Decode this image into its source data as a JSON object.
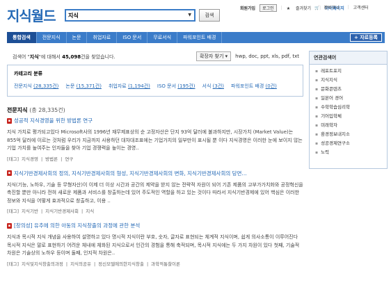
{
  "header": {
    "logo": "지식월드",
    "search_value": "지식",
    "search_button": "검색",
    "links_left": [
      "회원가입",
      "로그인",
      "즐겨찾기",
      "마이페이지"
    ],
    "links_right": [
      "장바구니",
      "고객센터"
    ]
  },
  "nav": {
    "tabs": [
      "통합검색",
      "전문지식",
      "논문",
      "취업자료",
      "ISO 문서",
      "무료서식",
      "파워포인트 배경"
    ],
    "register_button": "+ 자료등록"
  },
  "summary": {
    "prefix": "검색어 \"",
    "query": "지식",
    "middle": "\"에 대해서 ",
    "count": "45,098",
    "suffix": "건을 찾았습니다."
  },
  "tools": {
    "extension_button": "확장자 찾기 ▾",
    "extensions": "hwp, doc, ppt, xls, pdf, txt"
  },
  "category": {
    "title": "카테고리 분류",
    "items": [
      {
        "label": "전문지식",
        "count": "(28,335건)"
      },
      {
        "label": "논문",
        "count": "(15,371건)"
      },
      {
        "label": "취업자료",
        "count": "(1,194건)"
      },
      {
        "label": "ISO 문서",
        "count": "(195건)"
      },
      {
        "label": "서식",
        "count": "(3건)"
      },
      {
        "label": "파워포인트 배경",
        "count": "(0건)"
      }
    ]
  },
  "related": {
    "title": "연관검색어",
    "items": [
      "레포트포지",
      "지식지식",
      "문화콘텐츠",
      "일본어 경어",
      "수학학습심리학",
      "기어입학체",
      "미래학자",
      "환경정보내지소",
      "성공경제연구소",
      "노력"
    ]
  },
  "section": {
    "title": "전문지식",
    "count": "(총 28,335건)"
  },
  "results": [
    {
      "title": "성공적 지식경영을 위한 방법론 연구",
      "desc": "지식 가치로 평가되고있다 Microsoft사의 1996년 재무제표상의 순 고정자산은 단지 93억 달러에 불과하지만, 시장가치 (Market Value)는 855억 달러에 이르는 것처럼 우리가 지금까지 사용하던 대차대조표에는 기업가치의 일부만이 표시될 뿐 이다 지식경영은 이러한 눈에 보이지 않는 기업 가치를 높여주는 인자들을 찾아 기업 경쟁력을 높이는 경영..",
      "tags": [
        "[태그]",
        "지식경영",
        "|",
        "방법론",
        "|",
        "연구"
      ]
    },
    {
      "title": "지식기반경제사회의 정의, 지식기반경제사회의 형성, 지식기반경제사회의 변화, 지식기반경제사회의 당면...",
      "desc": "지식(기능, 노하우, 기술 등 무형자산)이 이제 더 이상 시간과 공간의 제약을 받지 않는 전략적 자원이 되어 기존 제품의 고부가가치화와 공정혁신을 촉진할 뿐만 아니라 전혀 새로운 제품과 서비스를 창출하는데 있어 주도적인 역할을 하고 있는 것이다 따라서 지식기반경제에 있어 핵심은 이러한 정보와 지식을 어떻게 효과적으로 창출하고, 이용 ..",
      "tags": [
        "[태그]",
        "지식기반",
        "|",
        "지식기반경제사회",
        "|",
        "지식"
      ]
    },
    {
      "title": "[창의성] 유추에 의한 아동의 지식창출의 과정에 관한 분석",
      "desc": "지식과 목시적 지식 개념을 사용하여 설명하고 있다 명시적 지식이란 부호, 숫자, 글자로 표현되는 체계적 지식이며, 쉽게 의사소통이 이루어진다 목시적 지식은 말로 표현하기 어려운 체내에 체화된 지식으로서 인간의 경험을 통해 축적되며, 목시적 지식에는 두 가지 차원이 있다 첫째, 기술적 차원은 기술상의 노하우 등이며 둘째, 인지적 차원은..",
      "tags": [
        "[태그]",
        "지식및지식창출의과정",
        "|",
        "지식의공유",
        "|",
        "정신모델에의한지식창출",
        "|",
        "과학적통찰이론"
      ]
    }
  ]
}
